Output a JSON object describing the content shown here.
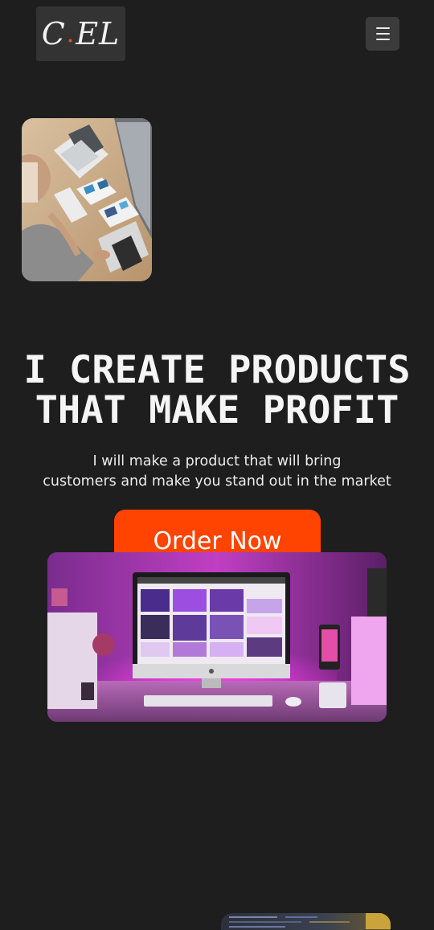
{
  "header": {
    "logo_left": "C",
    "logo_dot": ".",
    "logo_right": "EL",
    "menu_icon": "hamburger-menu-icon"
  },
  "hero": {
    "title_line1": "I CREATE PRODUCTS",
    "title_line2": "THAT MAKE PROFIT",
    "subtitle_line1": "I will make a product that will bring",
    "subtitle_line2": "customers and make you stand out in the market",
    "cta_label": "Order Now"
  },
  "colors": {
    "background": "#1e1e1e",
    "accent": "#ff4300",
    "logo_bg": "#333334",
    "menu_bg": "#3b3b3c"
  }
}
